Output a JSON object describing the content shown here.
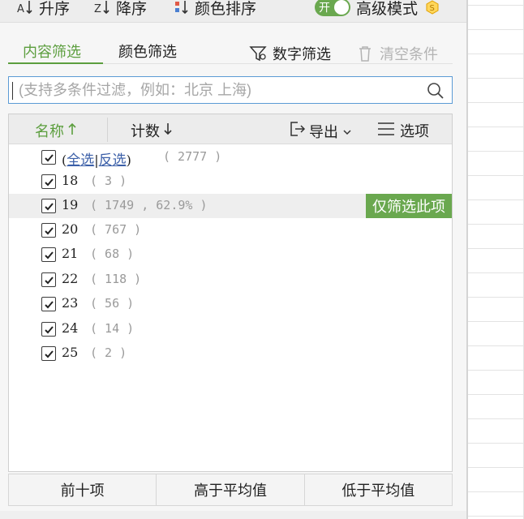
{
  "sort_toolbar": {
    "ascending_label": "升序",
    "descending_label": "降序",
    "color_sort_label": "颜色排序",
    "toggle_label": "开",
    "advanced_label": "高级模式"
  },
  "tabs": {
    "content_filter": "内容筛选",
    "color_filter": "颜色筛选"
  },
  "tools": {
    "number_filter": "数字筛选",
    "clear_conditions": "清空条件"
  },
  "search": {
    "placeholder": "(支持多条件过滤，例如：北京 上海)",
    "value": ""
  },
  "list_header": {
    "name": "名称",
    "count": "计数",
    "export": "导出",
    "options": "选项"
  },
  "select_all": {
    "open": "(",
    "all": "全选",
    "sep": "|",
    "invert": "反选",
    "close": ")",
    "count": "( 2777 )"
  },
  "items": [
    {
      "label": "18",
      "count": "( 3 )"
    },
    {
      "label": "19",
      "count": "( 1749 , 62.9% )"
    },
    {
      "label": "20",
      "count": "( 767 )"
    },
    {
      "label": "21",
      "count": "( 68 )"
    },
    {
      "label": "22",
      "count": "( 118 )"
    },
    {
      "label": "23",
      "count": "( 56 )"
    },
    {
      "label": "24",
      "count": "( 14 )"
    },
    {
      "label": "25",
      "count": "( 2 )"
    }
  ],
  "only_filter_label": "仅筛选此项",
  "bottom_buttons": {
    "top_ten": "前十项",
    "above_avg": "高于平均值",
    "below_avg": "低于平均值"
  },
  "colors": {
    "accent_green": "#5c9e3e",
    "focus_blue": "#5b9bd5",
    "link_blue": "#3b5fa8"
  }
}
